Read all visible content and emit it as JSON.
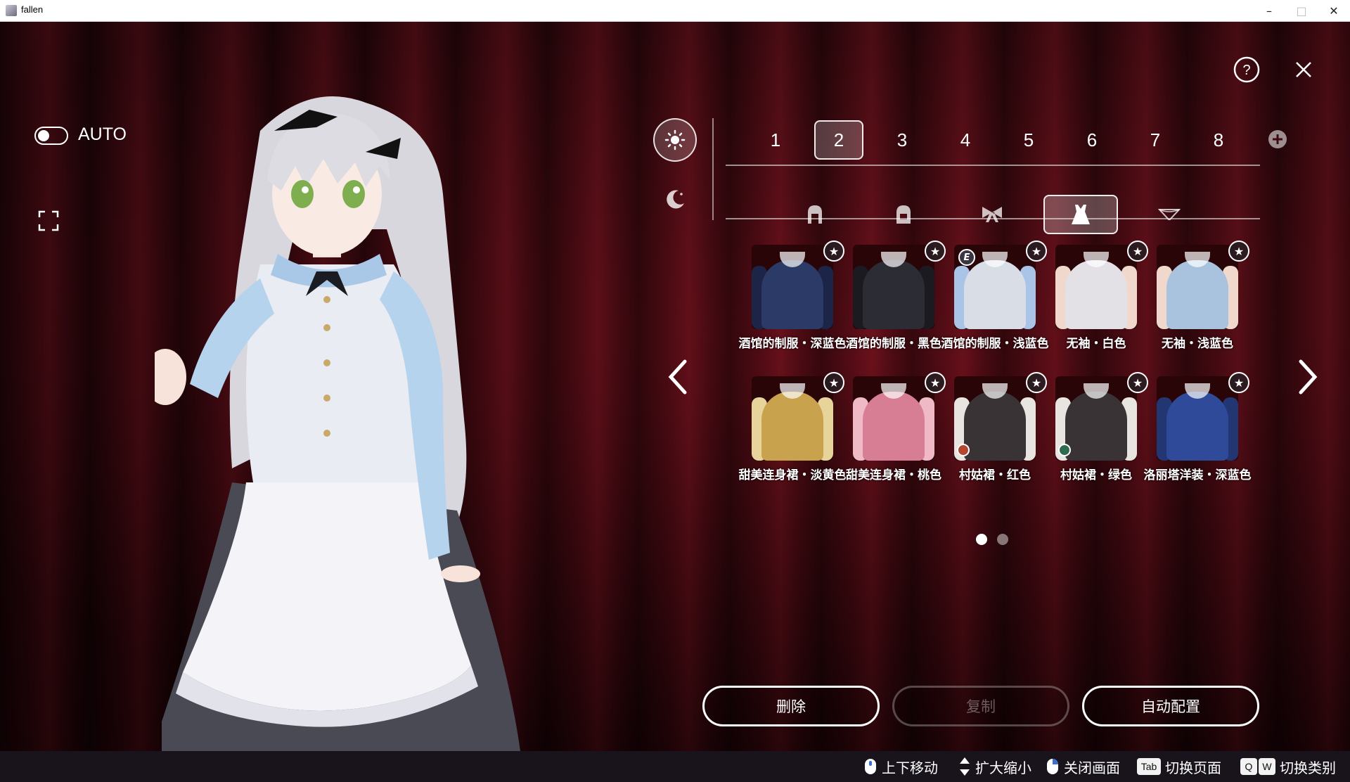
{
  "window": {
    "title": "fallen",
    "minimize": "–",
    "maximize": "□",
    "close": "✕"
  },
  "auto": {
    "label": "AUTO",
    "enabled": false
  },
  "slots": {
    "items": [
      "1",
      "2",
      "3",
      "4",
      "5",
      "6",
      "7",
      "8"
    ],
    "active": "2"
  },
  "categories": {
    "items": [
      {
        "icon": "wig-front-icon"
      },
      {
        "icon": "wig-back-icon"
      },
      {
        "icon": "ribbon-icon"
      },
      {
        "icon": "dress-icon"
      },
      {
        "icon": "underwear-icon"
      }
    ],
    "active_index": 3
  },
  "outfits": [
    {
      "label": "酒馆的制服・深蓝色",
      "color": "#2b3a66",
      "trim": "#1c2547"
    },
    {
      "label": "酒馆的制服・黑色",
      "color": "#2c2c34",
      "trim": "#1a1a20"
    },
    {
      "label": "酒馆的制服・浅蓝色",
      "color": "#d9dde6",
      "trim": "#a9c4e6",
      "badge": "E"
    },
    {
      "label": "无袖・白色",
      "color": "#e3e1e6",
      "trim": "#f0d9cc"
    },
    {
      "label": "无袖・浅蓝色",
      "color": "#a9c2de",
      "trim": "#f0d9cc"
    },
    {
      "label": "甜美连身裙・淡黄色",
      "color": "#c9a24e",
      "trim": "#e7d49a"
    },
    {
      "label": "甜美连身裙・桃色",
      "color": "#d77e95",
      "trim": "#efb9c6"
    },
    {
      "label": "村姑裙・红色",
      "color": "#3a3336",
      "trim": "#e8e4e0",
      "dot": "#b4452f"
    },
    {
      "label": "村姑裙・绿色",
      "color": "#3a3336",
      "trim": "#e8e4e0",
      "dot": "#2e6b4f"
    },
    {
      "label": "洛丽塔洋装・深蓝色",
      "color": "#2f4a98",
      "trim": "#223672"
    }
  ],
  "pagination": {
    "total": 2,
    "current": 1
  },
  "actions": {
    "delete": "删除",
    "copy": "复制",
    "auto_config": "自动配置"
  },
  "hints": {
    "move": "上下移动",
    "zoom": "扩大缩小",
    "close": "关闭画面",
    "tab_key": "Tab",
    "switch_page": "切换页面",
    "q_key": "Q",
    "w_key": "W",
    "switch_category": "切换类别"
  },
  "icons": {
    "help": "help-icon",
    "close": "close-icon",
    "sun": "sun-icon",
    "moon": "moon-icon",
    "fullscreen": "fullscreen-icon",
    "add": "plus-icon",
    "prev": "chevron-left-icon",
    "next": "chevron-right-icon"
  }
}
